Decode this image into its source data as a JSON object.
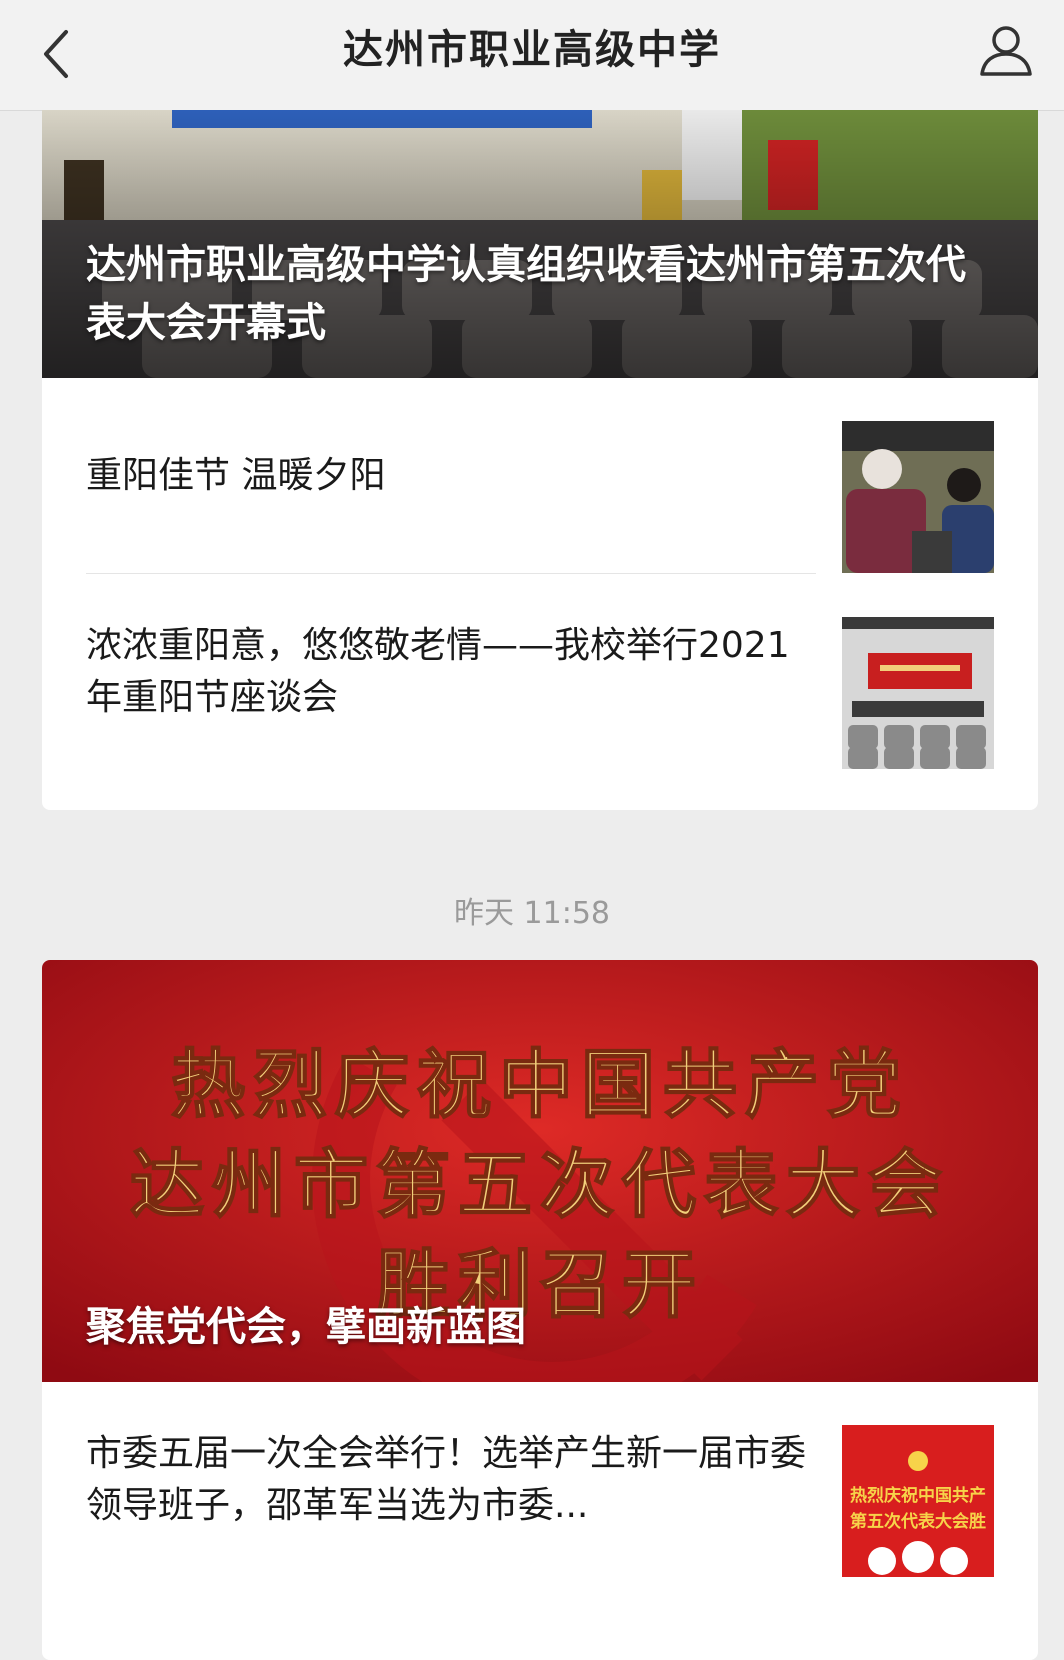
{
  "header": {
    "title": "达州市职业高级中学",
    "back_icon": "chevron-left-icon",
    "profile_icon": "user-icon"
  },
  "feed": [
    {
      "cover": {
        "title": "达州市职业高级中学认真组织收看达州市第五次代表大会开幕式"
      },
      "items": [
        {
          "title": "重阳佳节 温暖夕阳"
        },
        {
          "title": "浓浓重阳意，悠悠敬老情——我校举行2021年重阳节座谈会"
        }
      ]
    },
    {
      "timestamp": "昨天 11:58",
      "cover": {
        "title": "聚焦党代会，擘画新蓝图",
        "banner_lines": [
          "热烈庆祝中国共产党",
          "达州市第五次代表大会",
          "胜利召开"
        ]
      },
      "items": [
        {
          "title": "市委五届一次全会举行！选举产生新一届市委领导班子，邵革军当选为市委...",
          "thumb_lines": [
            "热烈庆祝中国共产",
            "第五次代表大会胜"
          ]
        }
      ]
    }
  ],
  "colors": {
    "header_bg": "#f2f2f2",
    "page_bg": "#ededed",
    "banner_red": "#c8141e",
    "banner_gold": "#f2cf7a"
  }
}
